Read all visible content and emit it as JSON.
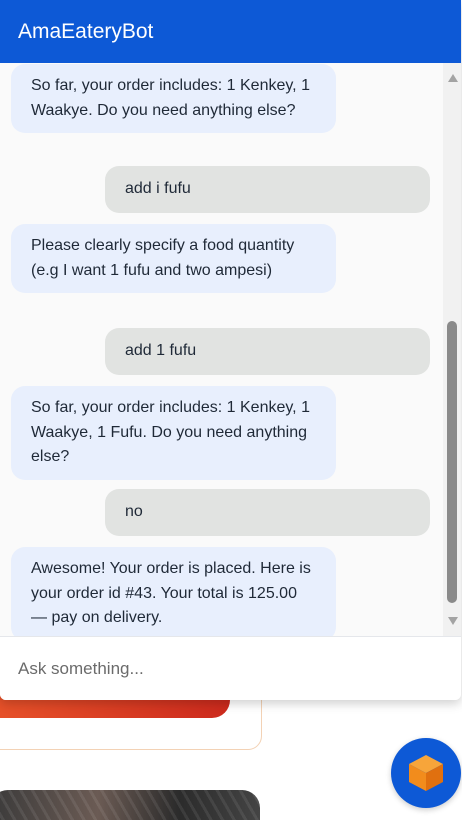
{
  "chat": {
    "title": "AmaEateryBot",
    "input_placeholder": "Ask something...",
    "messages": [
      {
        "role": "bot",
        "text": "So far, your order includes: 1 Kenkey, 1 Waakye. Do you need anything else?"
      },
      {
        "role": "user",
        "text": "add i fufu"
      },
      {
        "role": "bot",
        "text": "Please clearly specify a food quantity (e.g I want 1 fufu and two ampesi)"
      },
      {
        "role": "user",
        "text": "add 1 fufu"
      },
      {
        "role": "bot",
        "text": "So far, your order includes: 1 Kenkey, 1 Waakye, 1 Fufu. Do you need anything else?"
      },
      {
        "role": "user",
        "text": "no"
      },
      {
        "role": "bot",
        "text": "Awesome! Your order is placed. Here is your order id #43. Your total is 125.00 — pay on delivery."
      }
    ]
  },
  "colors": {
    "header": "#0d59d6",
    "bot_bubble": "#e8effd",
    "user_bubble": "#e1e3e1",
    "launcher_cube": "#f28c1c"
  },
  "launcher": {
    "icon": "cube-icon"
  }
}
